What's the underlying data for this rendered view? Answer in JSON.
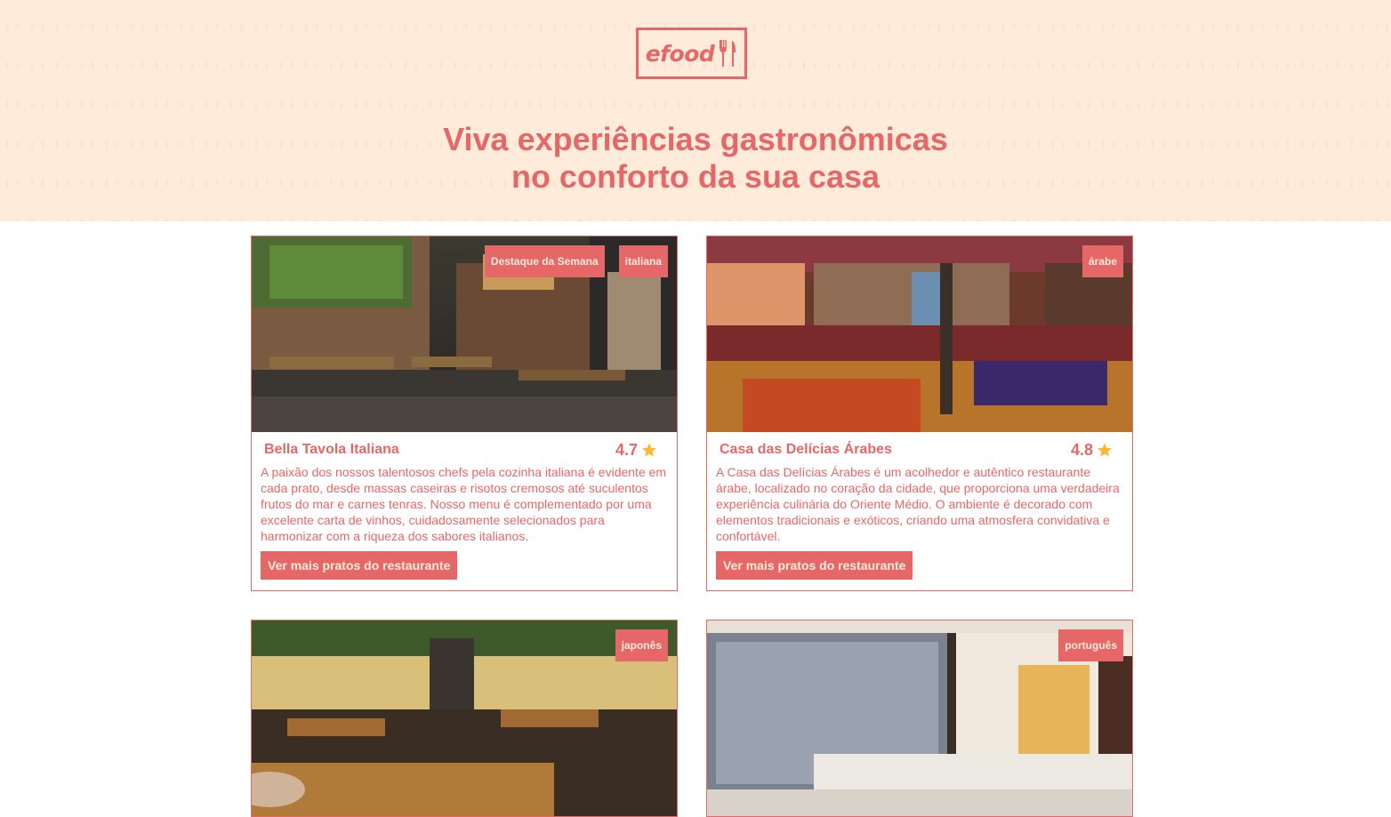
{
  "brand": {
    "logo_text": "efood",
    "logo_icon": "cutlery-icon",
    "accent_color": "#E66767",
    "hero_bg_color": "#FFEBD9"
  },
  "hero": {
    "headline_line1": "Viva experiências gastronômicas",
    "headline_line2": "no conforto da sua casa"
  },
  "restaurants": [
    {
      "name": "Bella Tavola Italiana",
      "rating": "4.7",
      "tags": [
        "Destaque da Semana",
        "italiana"
      ],
      "description": "A paixão dos nossos talentosos chefs pela cozinha italiana é evidente em cada prato, desde massas caseiras e risotos cremosos até suculentos frutos do mar e carnes tenras. Nosso menu é complementado por uma excelente carta de vinhos, cuidadosamente selecionados para harmonizar com a riqueza dos sabores italianos.",
      "button_label": "Ver mais pratos do restaurante"
    },
    {
      "name": "Casa das Delícias Árabes",
      "rating": "4.8",
      "tags": [
        "árabe"
      ],
      "description": "A Casa das Delícias Árabes é um acolhedor e autêntico restaurante árabe, localizado no coração da cidade, que proporciona uma verdadeira experiência culinária do Oriente Médio. O ambiente é decorado com elementos tradicionais e exóticos, criando uma atmosfera convidativa e confortável.",
      "button_label": "Ver mais pratos do restaurante"
    },
    {
      "tags": [
        "japonês"
      ]
    },
    {
      "tags": [
        "português"
      ]
    }
  ]
}
